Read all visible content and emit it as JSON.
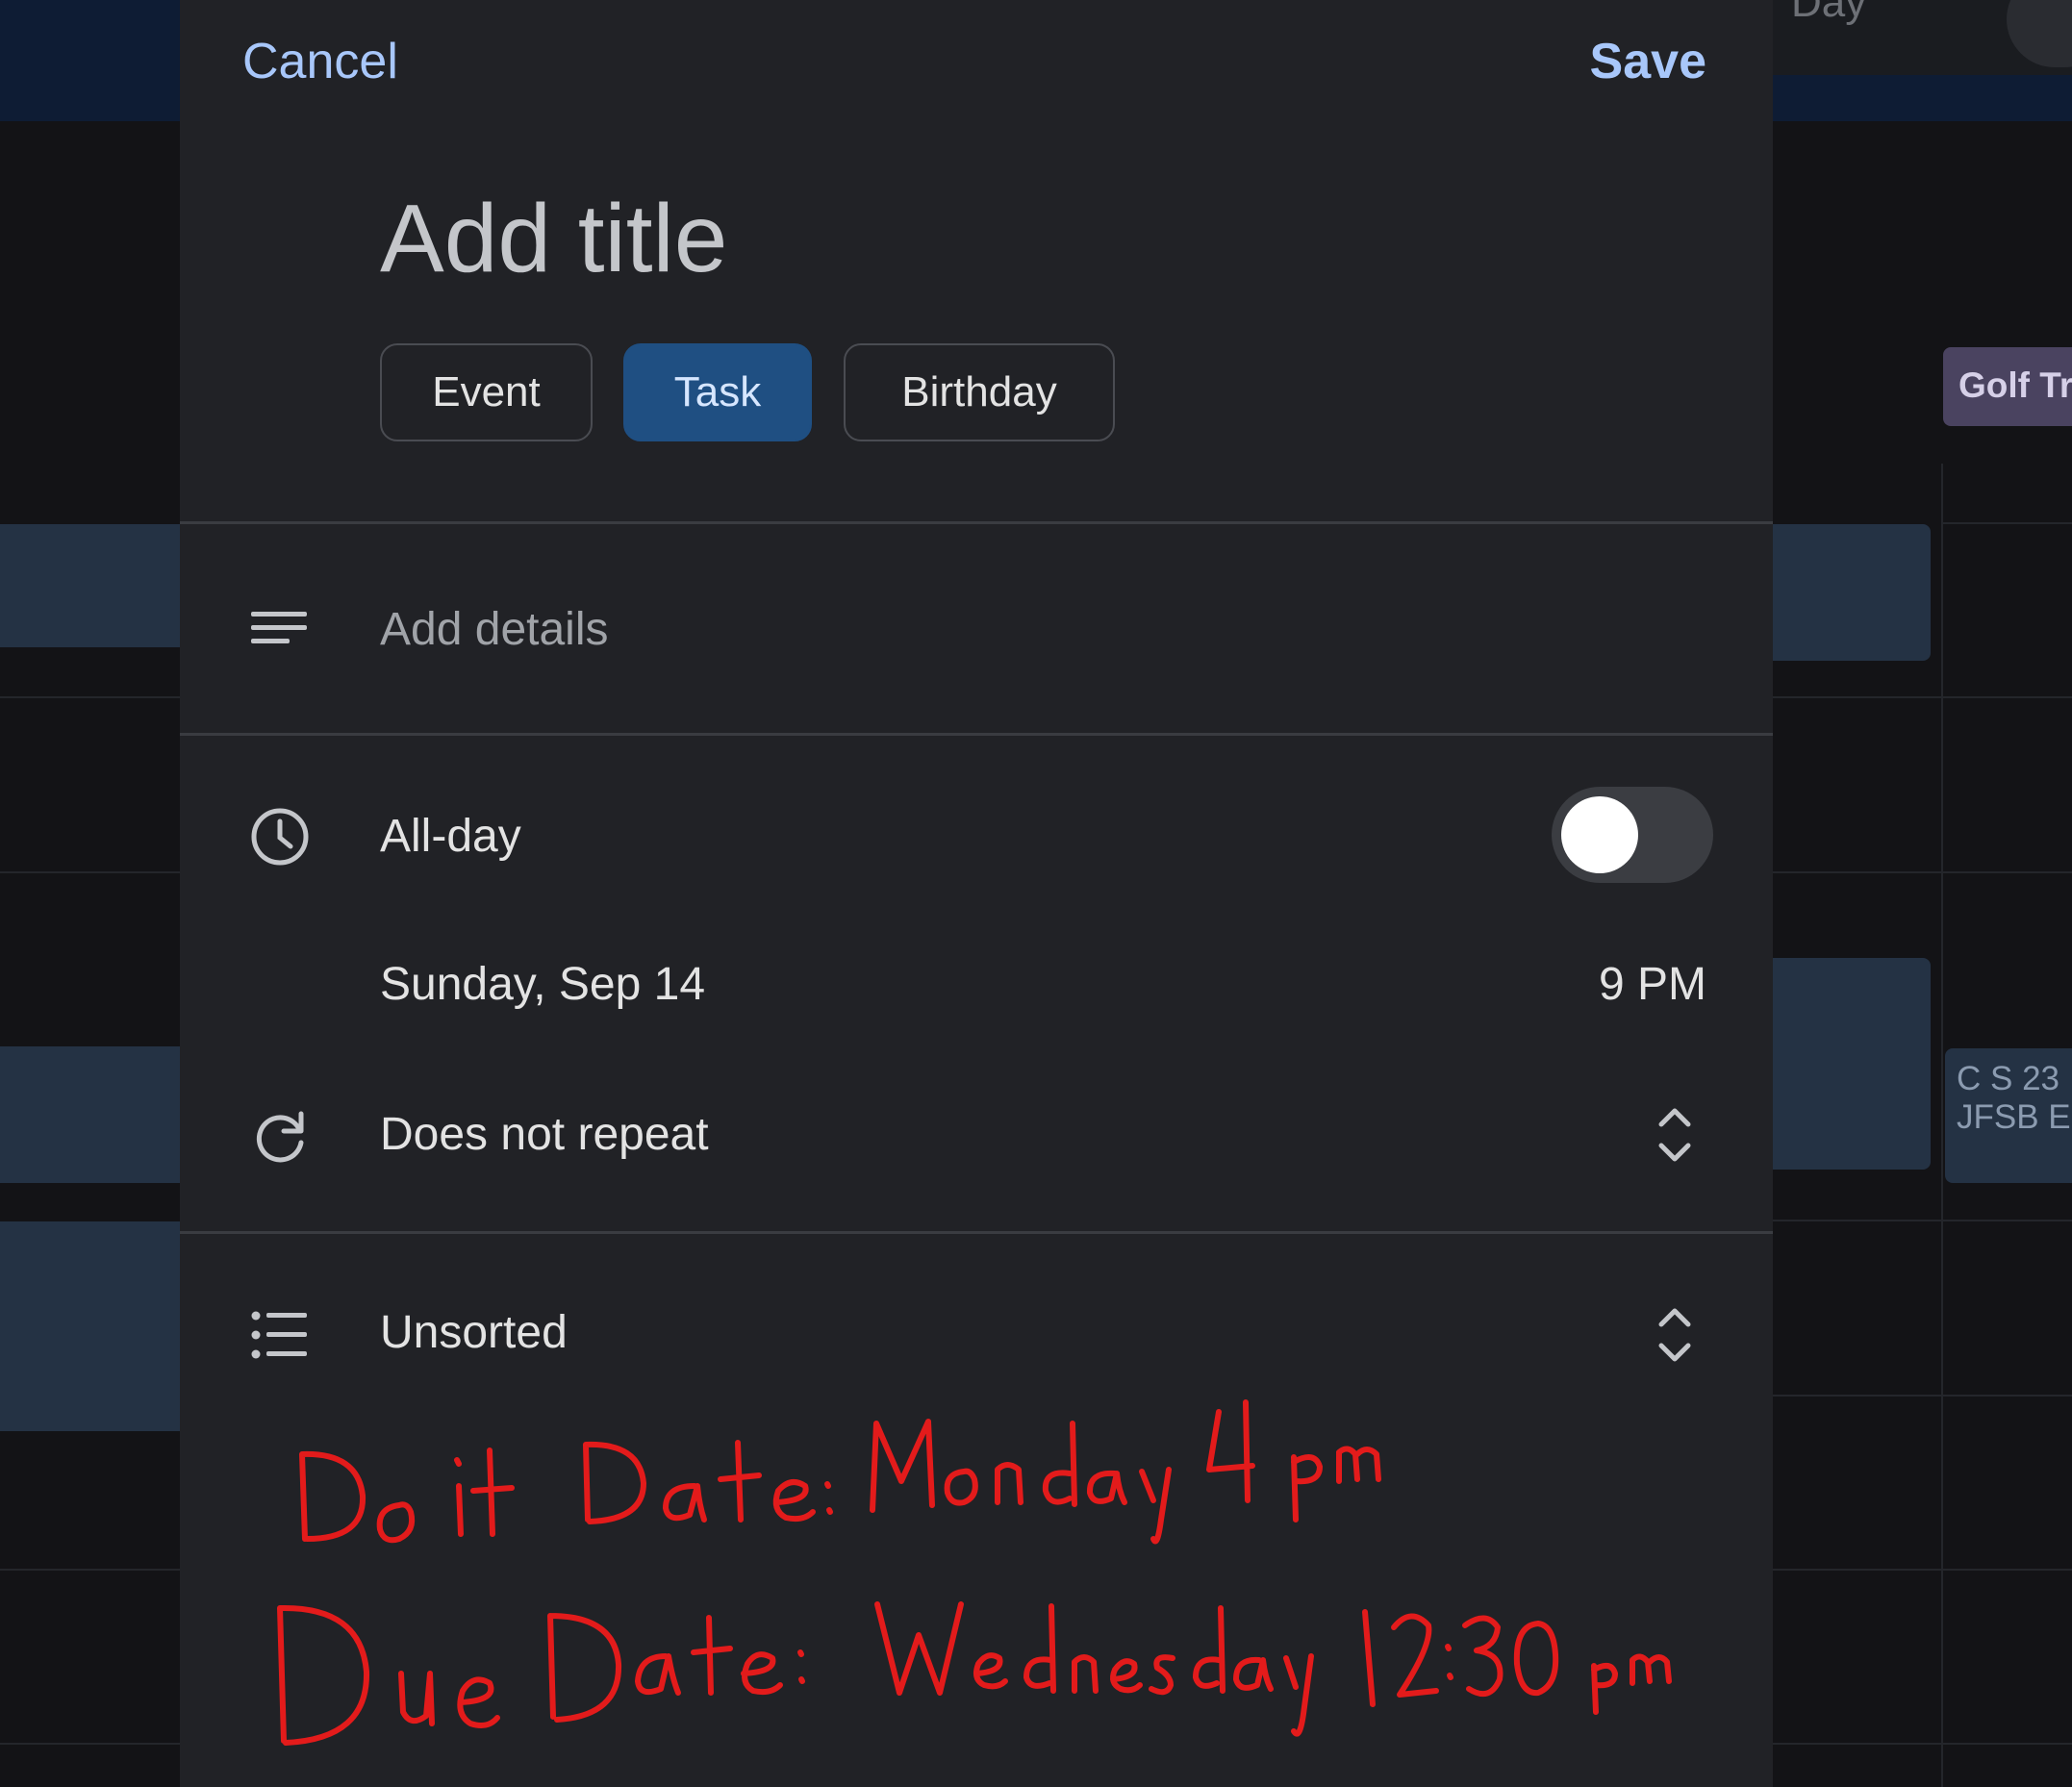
{
  "background": {
    "view_label": "Day",
    "golf_chip": "Golf Tr",
    "cs_chip_line1": "C S 23",
    "cs_chip_line2": "JFSB E"
  },
  "header": {
    "cancel_label": "Cancel",
    "save_label": "Save"
  },
  "title": {
    "placeholder": "Add title",
    "value": ""
  },
  "type_chips": [
    {
      "label": "Event",
      "selected": false
    },
    {
      "label": "Task",
      "selected": true
    },
    {
      "label": "Birthday",
      "selected": false
    }
  ],
  "details": {
    "placeholder": "Add details",
    "icon": "notes-icon"
  },
  "schedule": {
    "all_day_label": "All-day",
    "all_day_on": false,
    "date": "Sunday, Sep 14",
    "time": "9 PM",
    "icon": "clock-icon"
  },
  "repeat": {
    "label": "Does not repeat",
    "icon": "repeat-icon"
  },
  "list": {
    "label": "Unsorted",
    "icon": "list-icon"
  },
  "annotation": {
    "line1": "Do it Date: Monday 4 pm",
    "line2": "Due Date: Wednesday 12:30 pm",
    "color": "#e31b1b"
  },
  "colors": {
    "accent": "#a8c7fa",
    "selected_chip": "#1f4f82",
    "sheet_bg": "#212226"
  }
}
